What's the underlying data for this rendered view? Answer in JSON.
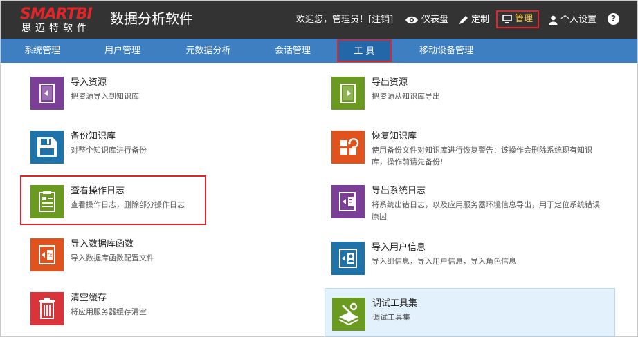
{
  "header": {
    "logo_top": "SMARTBI",
    "logo_bottom": "思迈特软件",
    "app_title": "数据分析软件",
    "welcome": "欢迎您，管理员！[",
    "logout": "注销",
    "welcome_end": "]",
    "dashboard": "仪表盘",
    "customize": "定制",
    "manage": "管理",
    "personal": "个人设置",
    "help": "?"
  },
  "menu": {
    "items": [
      "系统管理",
      "用户管理",
      "元数据分析",
      "会话管理",
      "工 具",
      "移动设备管理"
    ],
    "active_index": 4
  },
  "colors": {
    "header_bg": "#333333",
    "menu_bg": "#3d7fc1",
    "highlight_red": "#e0262a",
    "purple": "#7b3f98",
    "green": "#6a9a1f",
    "blue": "#1f73a8",
    "orange": "#e0531f",
    "red": "#d8343a"
  },
  "tools": [
    {
      "title": "导入资源",
      "desc": "把资源导入到知识库",
      "icon": "import-resource-icon"
    },
    {
      "title": "导出资源",
      "desc": "把资源从知识库导出",
      "icon": "export-resource-icon"
    },
    {
      "title": "备份知识库",
      "desc": "对整个知识库进行备份",
      "icon": "backup-icon"
    },
    {
      "title": "恢复知识库",
      "desc": "使用备份文件对知识库进行恢复警告：该操作会删除系统现有知识库，操作前请先备份!",
      "icon": "restore-icon"
    },
    {
      "title": "查看操作日志",
      "desc": "查看操作日志，删除部分操作日志",
      "icon": "operation-log-icon"
    },
    {
      "title": "导出系统日志",
      "desc": "将系统出错日志，以及应用服务器环境信息导出，用于定位系统错误原因",
      "icon": "export-log-icon"
    },
    {
      "title": "导入数据库函数",
      "desc": "导入数据库函数配置文件",
      "icon": "import-db-function-icon"
    },
    {
      "title": "导入用户信息",
      "desc": "导入组信息，导入用户信息，导入角色信息",
      "icon": "import-user-icon"
    },
    {
      "title": "清空缓存",
      "desc": "将应用服务器缓存清空",
      "icon": "trash-icon"
    },
    {
      "title": "调试工具集",
      "desc": "调试工具集",
      "icon": "debug-tools-icon"
    }
  ]
}
